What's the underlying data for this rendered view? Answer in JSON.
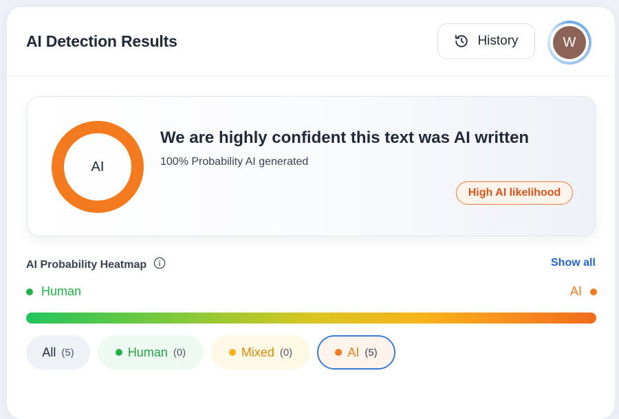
{
  "header": {
    "title": "AI Detection Results",
    "history_label": "History",
    "avatar_initial": "W"
  },
  "result": {
    "donut_label": "AI",
    "ai_probability_percent": 100,
    "headline": "We are highly confident this text was AI written",
    "subtext": "100% Probability AI generated",
    "badge": "High AI likelihood"
  },
  "heatmap": {
    "title": "AI Probability Heatmap",
    "show_all": "Show all",
    "legend_left": "Human",
    "legend_right": "AI"
  },
  "filters": [
    {
      "label": "All",
      "count": "(5)",
      "selected": false
    },
    {
      "label": "Human",
      "count": "(0)",
      "selected": false
    },
    {
      "label": "Mixed",
      "count": "(0)",
      "selected": false
    },
    {
      "label": "AI",
      "count": "(5)",
      "selected": true
    }
  ],
  "colors": {
    "accent_blue": "#2563c7",
    "ai_orange": "#f37a1f",
    "human_green": "#22b24a",
    "mixed_yellow": "#f5b01c",
    "avatar_bg": "#8d6257"
  },
  "icons": {
    "history": "history-clock-icon",
    "info": "info-icon"
  }
}
